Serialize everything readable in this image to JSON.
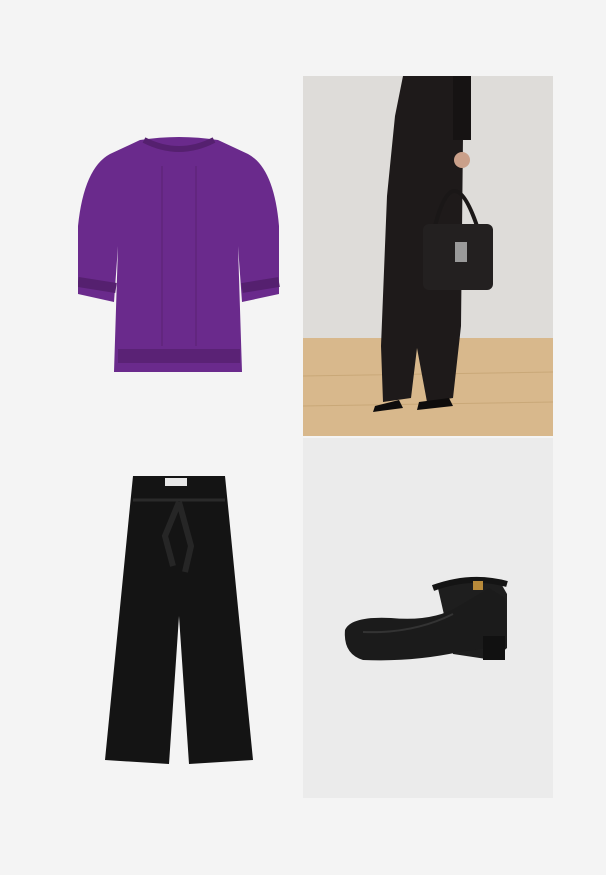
{
  "outfit": {
    "items": [
      {
        "icon": "purple-knit-top-icon",
        "color": "#6a2a8c"
      },
      {
        "icon": "model-with-handbag-icon",
        "color": "#1e1a1a"
      },
      {
        "icon": "black-wide-trousers-icon",
        "color": "#141414"
      },
      {
        "icon": "black-ankle-strap-shoe-icon",
        "color": "#1b1b1b"
      }
    ]
  }
}
